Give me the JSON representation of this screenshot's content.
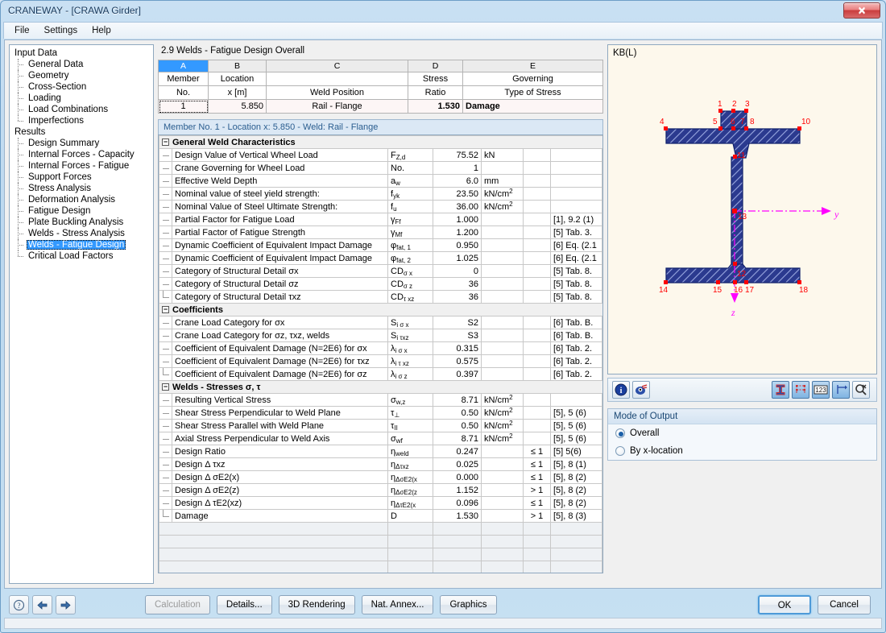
{
  "window": {
    "title": "CRANEWAY - [CRAWA Girder]",
    "close_label": "✕"
  },
  "menu": [
    {
      "label": "File"
    },
    {
      "label": "Settings"
    },
    {
      "label": "Help"
    }
  ],
  "sidebar": {
    "groups": [
      {
        "label": "Input Data",
        "items": [
          {
            "label": "General Data"
          },
          {
            "label": "Geometry"
          },
          {
            "label": "Cross-Section"
          },
          {
            "label": "Loading"
          },
          {
            "label": "Load Combinations"
          },
          {
            "label": "Imperfections"
          }
        ]
      },
      {
        "label": "Results",
        "items": [
          {
            "label": "Design Summary"
          },
          {
            "label": "Internal Forces - Capacity"
          },
          {
            "label": "Internal Forces - Fatigue"
          },
          {
            "label": "Support Forces"
          },
          {
            "label": "Stress Analysis"
          },
          {
            "label": "Deformation Analysis"
          },
          {
            "label": "Fatigue Design"
          },
          {
            "label": "Plate Buckling Analysis"
          },
          {
            "label": "Welds - Stress Analysis"
          },
          {
            "label": "Welds - Fatigue Design"
          },
          {
            "label": "Critical Load Factors"
          }
        ]
      }
    ],
    "selected": "Welds - Fatigue Design"
  },
  "main": {
    "panel_title": "2.9 Welds - Fatigue Design Overall",
    "overview": {
      "column_letters": [
        "A",
        "B",
        "C",
        "D",
        "E"
      ],
      "headers_line1": [
        "Member",
        "Location",
        "",
        "Stress",
        "Governing"
      ],
      "headers_line2": [
        "No.",
        "x [m]",
        "Weld Position",
        "Ratio",
        "Type of Stress"
      ],
      "rows": [
        {
          "member_no": "1",
          "location": "5.850",
          "weld_position": "Rail - Flange",
          "stress_ratio": "1.530",
          "governing": "Damage"
        }
      ]
    },
    "member_caption": "Member No.  1  -  Location x:  5.850  -  Weld: Rail - Flange",
    "sections": [
      {
        "title": "General Weld Characteristics",
        "collapse_glyph": "−",
        "rows": [
          {
            "label": "Design Value of Vertical Wheel Load",
            "symbol": "F",
            "sub": "Z,d",
            "value": "75.52",
            "unit": "kN",
            "unit_sup": "",
            "limit": "",
            "reference": "",
            "over": false
          },
          {
            "label": "Crane Governing for Wheel Load",
            "symbol": "No.",
            "sub": "",
            "value": "1",
            "unit": "",
            "unit_sup": "",
            "limit": "",
            "reference": "",
            "over": false
          },
          {
            "label": "Effective Weld Depth",
            "symbol": "a",
            "sub": "w",
            "value": "6.0",
            "unit": "mm",
            "unit_sup": "",
            "limit": "",
            "reference": "",
            "over": false
          },
          {
            "label": "Nominal value of steel yield strength:",
            "symbol": "f",
            "sub": "yk",
            "value": "23.50",
            "unit": "kN/cm",
            "unit_sup": "2",
            "limit": "",
            "reference": "",
            "over": false
          },
          {
            "label": "Nominal Value of Steel Ultimate Strength:",
            "symbol": "f",
            "sub": "u",
            "value": "36.00",
            "unit": "kN/cm",
            "unit_sup": "2",
            "limit": "",
            "reference": "",
            "over": false
          },
          {
            "label": "Partial Factor for Fatigue Load",
            "symbol": "γ",
            "sub": "Ff",
            "value": "1.000",
            "unit": "",
            "unit_sup": "",
            "limit": "",
            "reference": "[1], 9.2 (1)",
            "over": false
          },
          {
            "label": "Partial Factor of Fatigue Strength",
            "symbol": "γ",
            "sub": "Mf",
            "value": "1.200",
            "unit": "",
            "unit_sup": "",
            "limit": "",
            "reference": "[5] Tab. 3.",
            "over": false
          },
          {
            "label": "Dynamic Coefficient of Equivalent Impact Damage",
            "symbol": "φ",
            "sub": "fat, 1",
            "value": "0.950",
            "unit": "",
            "unit_sup": "",
            "limit": "",
            "reference": "[6] Eq. (2.1",
            "over": false
          },
          {
            "label": "Dynamic Coefficient of Equivalent Impact Damage",
            "symbol": "φ",
            "sub": "fat, 2",
            "value": "1.025",
            "unit": "",
            "unit_sup": "",
            "limit": "",
            "reference": "[6] Eq. (2.1",
            "over": false
          },
          {
            "label": "Category of Structural Detail σx",
            "symbol": "CD",
            "sub": "σ x",
            "value": "0",
            "unit": "",
            "unit_sup": "",
            "limit": "",
            "reference": "[5] Tab. 8.",
            "over": false
          },
          {
            "label": "Category of Structural Detail σz",
            "symbol": "CD",
            "sub": "σ z",
            "value": "36",
            "unit": "",
            "unit_sup": "",
            "limit": "",
            "reference": "[5] Tab. 8.",
            "over": false
          },
          {
            "label": "Category of Structural Detail τxz",
            "symbol": "CD",
            "sub": "τ xz",
            "value": "36",
            "unit": "",
            "unit_sup": "",
            "limit": "",
            "reference": "[5] Tab. 8.",
            "over": false
          }
        ]
      },
      {
        "title": "Coefficients",
        "collapse_glyph": "−",
        "rows": [
          {
            "label": "Crane Load Category for σx",
            "symbol": "S",
            "sub": "i σ x",
            "value": "S2",
            "unit": "",
            "unit_sup": "",
            "limit": "",
            "reference": "[6] Tab. B.",
            "over": false
          },
          {
            "label": "Crane Load Category for σz, τxz, welds",
            "symbol": "S",
            "sub": "i τxz",
            "value": "S3",
            "unit": "",
            "unit_sup": "",
            "limit": "",
            "reference": "[6] Tab. B.",
            "over": false
          },
          {
            "label": "Coefficient of Equivalent Damage (N=2E6) for σx",
            "symbol": "λ",
            "sub": "i σ x",
            "value": "0.315",
            "unit": "",
            "unit_sup": "",
            "limit": "",
            "reference": "[6] Tab. 2.",
            "over": false
          },
          {
            "label": "Coefficient of Equivalent Damage (N=2E6) for τxz",
            "symbol": "λ",
            "sub": "i τ xz",
            "value": "0.575",
            "unit": "",
            "unit_sup": "",
            "limit": "",
            "reference": "[6] Tab. 2.",
            "over": false
          },
          {
            "label": "Coefficient of Equivalent Damage (N=2E6) for σz",
            "symbol": "λ",
            "sub": "i σ z",
            "value": "0.397",
            "unit": "",
            "unit_sup": "",
            "limit": "",
            "reference": "[6] Tab. 2.",
            "over": false
          }
        ]
      },
      {
        "title": "Welds - Stresses σ, τ",
        "collapse_glyph": "−",
        "rows": [
          {
            "label": "Resulting Vertical Stress",
            "symbol": "σ",
            "sub": "w,z",
            "value": "8.71",
            "unit": "kN/cm",
            "unit_sup": "2",
            "limit": "",
            "reference": "",
            "over": false
          },
          {
            "label": "Shear Stress Perpendicular to Weld Plane",
            "symbol": "τ",
            "sub": "⊥",
            "value": "0.50",
            "unit": "kN/cm",
            "unit_sup": "2",
            "limit": "",
            "reference": "[5], 5 (6)",
            "over": false
          },
          {
            "label": "Shear Stress Parallel with Weld Plane",
            "symbol": "τ",
            "sub": "II",
            "value": "0.50",
            "unit": "kN/cm",
            "unit_sup": "2",
            "limit": "",
            "reference": "[5], 5 (6)",
            "over": false
          },
          {
            "label": "Axial Stress Perpendicular to Weld Axis",
            "symbol": "σ",
            "sub": "wf",
            "value": "8.71",
            "unit": "kN/cm",
            "unit_sup": "2",
            "limit": "",
            "reference": "[5], 5 (6)",
            "over": false
          },
          {
            "label": "Design Ratio",
            "symbol": "η",
            "sub": "weld",
            "value": "0.247",
            "unit": "",
            "unit_sup": "",
            "limit": "≤ 1",
            "reference": "[5] 5(6)",
            "over": false
          },
          {
            "label": "Design  Δ τxz",
            "symbol": "η",
            "sub": "Δτxz",
            "value": "0.025",
            "unit": "",
            "unit_sup": "",
            "limit": "≤ 1",
            "reference": "[5], 8 (1)",
            "over": false
          },
          {
            "label": "Design  Δ σE2(x)",
            "symbol": "η",
            "sub": "ΔσE2(x",
            "value": "0.000",
            "unit": "",
            "unit_sup": "",
            "limit": "≤ 1",
            "reference": "[5], 8 (2)",
            "over": false
          },
          {
            "label": "Design  Δ σE2(z)",
            "symbol": "η",
            "sub": "ΔσE2(z",
            "value": "1.152",
            "unit": "",
            "unit_sup": "",
            "limit": "> 1",
            "reference": "[5], 8 (2)",
            "over": true
          },
          {
            "label": "Design  Δ τE2(xz)",
            "symbol": "η",
            "sub": "ΔτE2(x",
            "value": "0.096",
            "unit": "",
            "unit_sup": "",
            "limit": "≤ 1",
            "reference": "[5], 8 (2)",
            "over": false
          },
          {
            "label": "Damage",
            "symbol": "D",
            "sub": "",
            "value": "1.530",
            "unit": "",
            "unit_sup": "",
            "limit": "> 1",
            "reference": "[5], 8 (3)",
            "over": true
          }
        ]
      }
    ]
  },
  "graphics": {
    "label": "KB(L)",
    "axis_y_label": "y",
    "axis_z_label": "z",
    "node_numbers": [
      "1",
      "2",
      "3",
      "4",
      "5",
      "6",
      "7",
      "8",
      "10",
      "11",
      "12",
      "13",
      "14",
      "15",
      "16",
      "17",
      "18"
    ],
    "colors": {
      "section_fill": "#2b3a8f",
      "node": "#ff0000",
      "axis": "#ff00ff",
      "background": "#fdf8ec"
    },
    "toolbar_left": [
      {
        "name": "info-icon",
        "label": "i"
      },
      {
        "name": "render-settings-icon",
        "label": ""
      }
    ],
    "toolbar_right": [
      {
        "name": "cross-section-icon",
        "label": "",
        "active": true
      },
      {
        "name": "nodes-grid-icon",
        "label": "",
        "active": true
      },
      {
        "name": "numbering-icon",
        "label": "123",
        "active": true
      },
      {
        "name": "dimensions-icon",
        "label": "",
        "active": true
      },
      {
        "name": "zoom-reset-icon",
        "label": "",
        "active": false
      }
    ]
  },
  "mode_of_output": {
    "title": "Mode of Output",
    "options": [
      {
        "label": "Overall",
        "selected": true
      },
      {
        "label": "By x-location",
        "selected": false
      }
    ]
  },
  "bottombar": {
    "icon_buttons": [
      {
        "name": "help-button",
        "glyph": "?"
      },
      {
        "name": "previous-button",
        "glyph": "←"
      },
      {
        "name": "next-button",
        "glyph": "→"
      }
    ],
    "buttons": [
      {
        "label": "Calculation",
        "disabled": true
      },
      {
        "label": "Details...",
        "disabled": false
      },
      {
        "label": "3D Rendering",
        "disabled": false
      },
      {
        "label": "Nat. Annex...",
        "disabled": false
      },
      {
        "label": "Graphics",
        "disabled": false
      }
    ],
    "ok_label": "OK",
    "cancel_label": "Cancel"
  }
}
